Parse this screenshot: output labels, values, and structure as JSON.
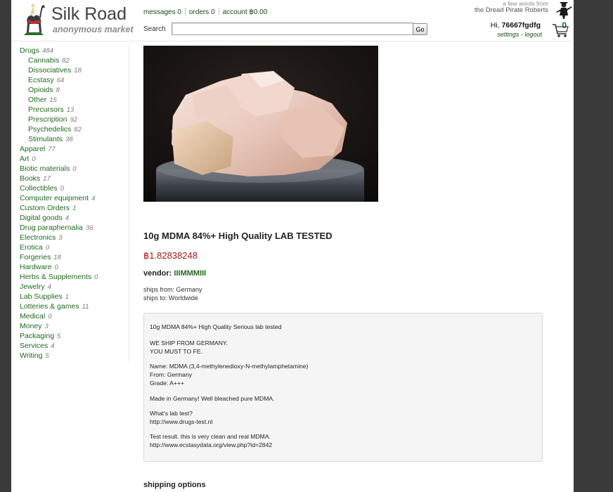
{
  "brand": {
    "title": "Silk Road",
    "subtitle": "anonymous market"
  },
  "topnav": {
    "messages_label": "messages",
    "messages_count": "0",
    "orders_label": "orders",
    "orders_count": "0",
    "account_label": "account",
    "account_balance": "฿0.00"
  },
  "search": {
    "label": "Search",
    "value": "",
    "button_label": "Go"
  },
  "dpr": {
    "line1": "a few words from",
    "line2": "the Dread Pirate Roberts"
  },
  "user": {
    "greeting": "Hi,",
    "username": "76667fgdfg",
    "settings_label": "settings",
    "separator": "-",
    "logout_label": "logout",
    "cart_count": "0"
  },
  "sidebar": {
    "categories": [
      {
        "name": "Drugs",
        "count": "484",
        "sub": false
      },
      {
        "name": "Cannabis",
        "count": "82",
        "sub": true
      },
      {
        "name": "Dissociatives",
        "count": "18",
        "sub": true
      },
      {
        "name": "Ecstasy",
        "count": "64",
        "sub": true
      },
      {
        "name": "Opioids",
        "count": "8",
        "sub": true
      },
      {
        "name": "Other",
        "count": "15",
        "sub": true
      },
      {
        "name": "Precursors",
        "count": "13",
        "sub": true
      },
      {
        "name": "Prescription",
        "count": "92",
        "sub": true
      },
      {
        "name": "Psychedelics",
        "count": "82",
        "sub": true
      },
      {
        "name": "Stimulants",
        "count": "38",
        "sub": true
      },
      {
        "name": "Apparel",
        "count": "77",
        "sub": false
      },
      {
        "name": "Art",
        "count": "0",
        "sub": false
      },
      {
        "name": "Biotic materials",
        "count": "0",
        "sub": false
      },
      {
        "name": "Books",
        "count": "17",
        "sub": false
      },
      {
        "name": "Collectibles",
        "count": "0",
        "sub": false
      },
      {
        "name": "Computer equipment",
        "count": "4",
        "sub": false
      },
      {
        "name": "Custom Orders",
        "count": "1",
        "sub": false
      },
      {
        "name": "Digital goods",
        "count": "4",
        "sub": false
      },
      {
        "name": "Drug paraphernalia",
        "count": "36",
        "sub": false
      },
      {
        "name": "Electronics",
        "count": "3",
        "sub": false
      },
      {
        "name": "Erotica",
        "count": "0",
        "sub": false
      },
      {
        "name": "Forgeries",
        "count": "18",
        "sub": false
      },
      {
        "name": "Hardware",
        "count": "0",
        "sub": false
      },
      {
        "name": "Herbs & Supplements",
        "count": "0",
        "sub": false
      },
      {
        "name": "Jewelry",
        "count": "4",
        "sub": false
      },
      {
        "name": "Lab Supplies",
        "count": "1",
        "sub": false
      },
      {
        "name": "Lotteries & games",
        "count": "11",
        "sub": false
      },
      {
        "name": "Medical",
        "count": "0",
        "sub": false
      },
      {
        "name": "Money",
        "count": "3",
        "sub": false
      },
      {
        "name": "Packaging",
        "count": "5",
        "sub": false
      },
      {
        "name": "Services",
        "count": "4",
        "sub": false
      },
      {
        "name": "Writing",
        "count": "5",
        "sub": false
      }
    ]
  },
  "product": {
    "title": "10g MDMA 84%+ High Quality LAB TESTED",
    "price": "฿1.82838248",
    "vendor_label": "vendor:",
    "vendor_name": "IIIMMMIII",
    "ships_from": "ships from: Germany",
    "ships_to": "ships to: Worldwide",
    "description": [
      [
        "10g MDMA 84%+ High Quality  Serious lab tested"
      ],
      [
        "WE SHIP FROM GERMANY.",
        "YOU MUST TO FE."
      ],
      [
        "Name: MDMA (3,4-methylenedioxy-N-methylamphetamine)",
        "From: Germany",
        "Grade: A+++"
      ],
      [
        "Made in Germany! Well bleached pure MDMA."
      ],
      [
        "What's lab test?",
        "http://www.drugs-test.nl"
      ],
      [
        "Test result. this is very clean and real MDMA.",
        "http://www.ecstasydata.org/view.php?id=2842"
      ]
    ],
    "shipping_heading": "shipping options"
  },
  "colors": {
    "link_green": "#1f6a1f",
    "price_red": "#a01818",
    "outer_background": "#3a3a3a"
  }
}
